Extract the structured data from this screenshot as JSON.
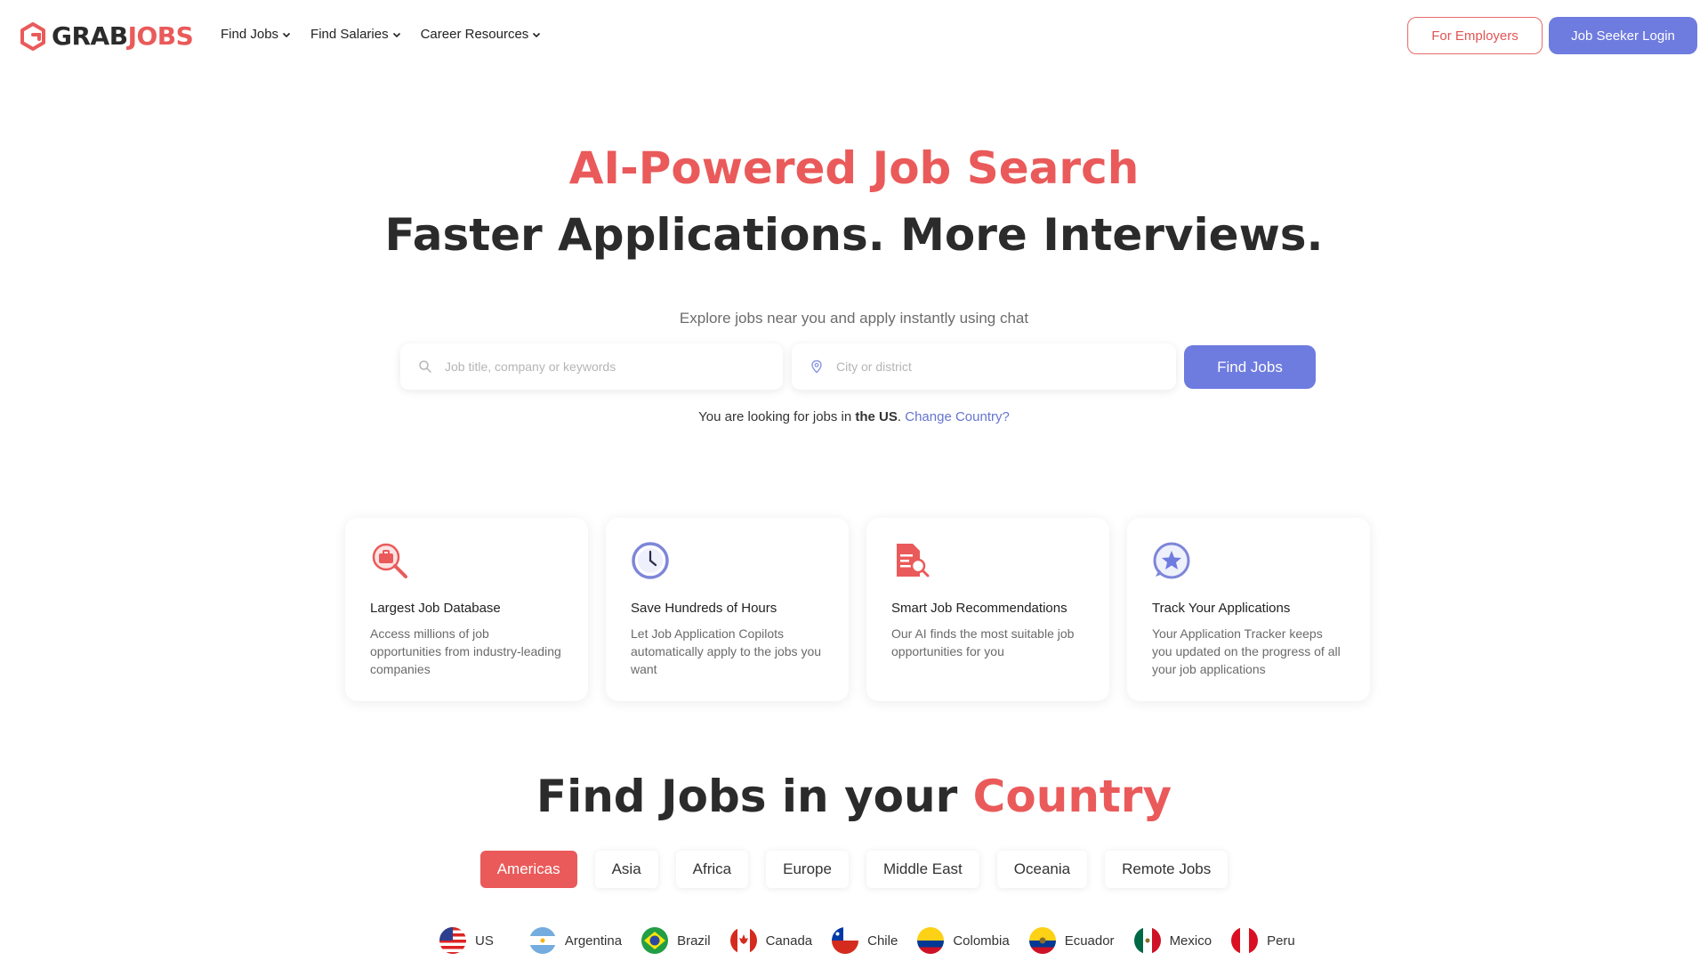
{
  "brand": {
    "part1": "GRAB",
    "part2": "JOBS",
    "accent": "#ea5a5a",
    "primary": "#6e7bdf"
  },
  "nav": {
    "menu": [
      {
        "label": "Find Jobs",
        "icon": "chevron-down-icon"
      },
      {
        "label": "Find Salaries",
        "icon": "chevron-down-icon"
      },
      {
        "label": "Career Resources",
        "icon": "chevron-down-icon"
      }
    ],
    "employers_label": "For Employers",
    "login_label": "Job Seeker Login"
  },
  "hero": {
    "title_line1": "AI-Powered Job Search",
    "title_line2": "Faster Applications. More Interviews.",
    "subtitle": "Explore jobs near you and apply instantly using chat",
    "keyword_placeholder": "Job title, company or keywords",
    "location_placeholder": "City or district",
    "find_label": "Find Jobs",
    "country_prefix": "You are looking for jobs in ",
    "country_name": "the US",
    "country_suffix": ". ",
    "change_country": "Change Country?"
  },
  "features": [
    {
      "icon": "briefcase-search-icon",
      "title": "Largest Job Database",
      "desc": "Access millions of job opportunities from industry-leading companies"
    },
    {
      "icon": "clock-icon",
      "title": "Save Hundreds of Hours",
      "desc": "Let Job Application Copilots automatically apply to the jobs you want"
    },
    {
      "icon": "document-search-icon",
      "title": "Smart Job Recommendations",
      "desc": "Our AI finds the most suitable job opportunities for you"
    },
    {
      "icon": "star-badge-icon",
      "title": "Track Your Applications",
      "desc": "Your Application Tracker keeps you updated on the progress of all your job applications"
    }
  ],
  "country_section": {
    "title_prefix": "Find Jobs in your ",
    "title_highlight": "Country",
    "regions": [
      "Americas",
      "Asia",
      "Africa",
      "Europe",
      "Middle East",
      "Oceania",
      "Remote Jobs"
    ],
    "active_region": "Americas",
    "countries": [
      "US",
      "Argentina",
      "Brazil",
      "Canada",
      "Chile",
      "Colombia",
      "Ecuador",
      "Mexico",
      "Peru"
    ]
  }
}
